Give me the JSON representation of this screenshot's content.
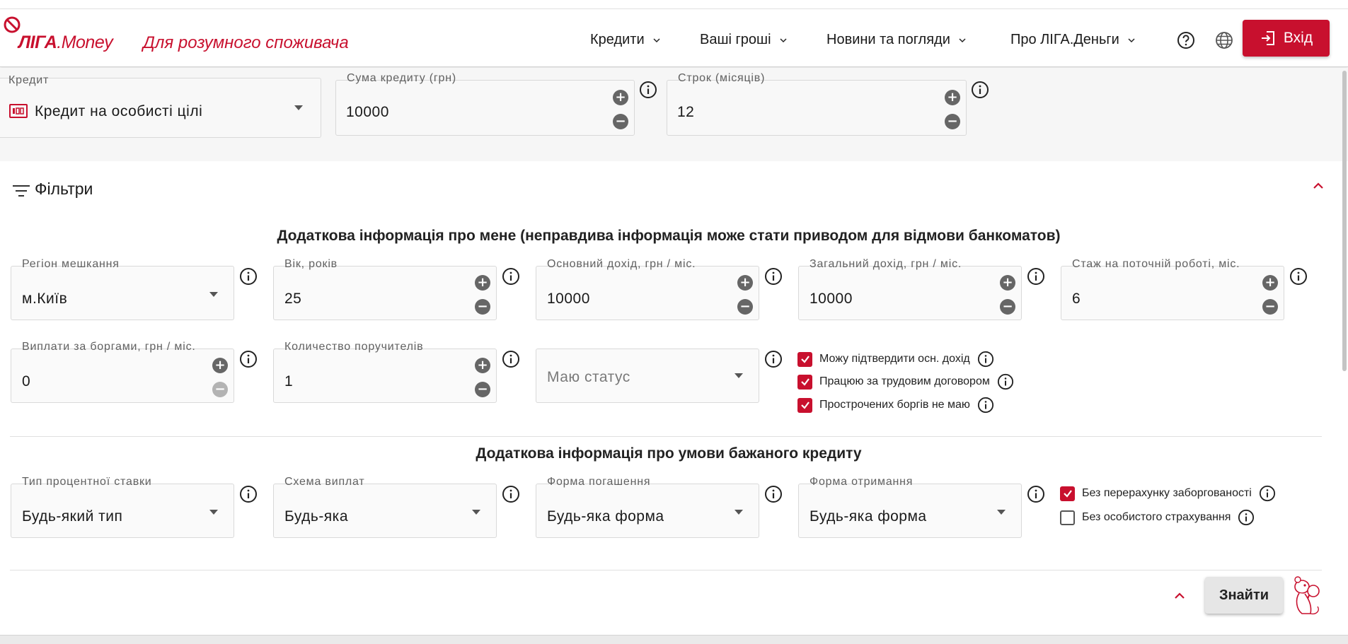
{
  "header": {
    "logo_text": "ЛІГА",
    "logo_money": ".Money",
    "tagline": "Для розумного споживача",
    "nav": [
      "Кредити",
      "Ваші гроші",
      "Новини та погляди",
      "Про ЛІГА.Деньги"
    ],
    "login_label": "Вхід",
    "brand_color": "#c8102e"
  },
  "loan": {
    "type_label": "Кредит",
    "type_value": "Кредит на особисті цілі",
    "amount_label": "Сума кредиту (грн)",
    "amount_value": "10000",
    "term_label": "Строк (місяців)",
    "term_value": "12"
  },
  "filters": {
    "title": "Фільтри",
    "section1_heading": "Додаткова інформація про мене (неправдива інформація може стати приводом для відмови банкоматов)",
    "region_label": "Регіон мешкання",
    "region_value": "м.Київ",
    "age_label": "Вік, років",
    "age_value": "25",
    "main_income_label": "Основний дохід, грн / міс.",
    "main_income_value": "10000",
    "total_income_label": "Загальний дохід, грн / міс.",
    "total_income_value": "10000",
    "experience_label": "Стаж на поточній роботі, міс.",
    "experience_value": "6",
    "debt_label": "Виплати за боргами, грн / міс.",
    "debt_value": "0",
    "guarantors_label": "Количество поручителів",
    "guarantors_value": "1",
    "status_placeholder": "Маю статус",
    "checks1": [
      {
        "label": "Можу підтвердити осн. дохід",
        "checked": true
      },
      {
        "label": "Працюю за трудовим договором",
        "checked": true
      },
      {
        "label": "Прострочених боргів не маю",
        "checked": true
      }
    ],
    "section2_heading": "Додаткова інформація про умови бажаного кредиту",
    "rate_label": "Тип процентної ставки",
    "rate_value": "Будь-який тип",
    "scheme_label": "Схема виплат",
    "scheme_value": "Будь-яка",
    "repay_label": "Форма погашення",
    "repay_value": "Будь-яка форма",
    "receive_label": "Форма отримання",
    "receive_value": "Будь-яка форма",
    "checks2": [
      {
        "label": "Без перерахунку заборгованості",
        "checked": true
      },
      {
        "label": "Без особистого страхування",
        "checked": false
      }
    ],
    "find_label": "Знайти"
  },
  "icons": [
    "logo-icon",
    "chevron-down-icon",
    "help-icon",
    "globe-icon",
    "login-icon",
    "credit-card-icon",
    "plus-icon",
    "minus-icon",
    "info-icon",
    "filter-icon",
    "chevron-up-icon",
    "mascot-icon"
  ]
}
